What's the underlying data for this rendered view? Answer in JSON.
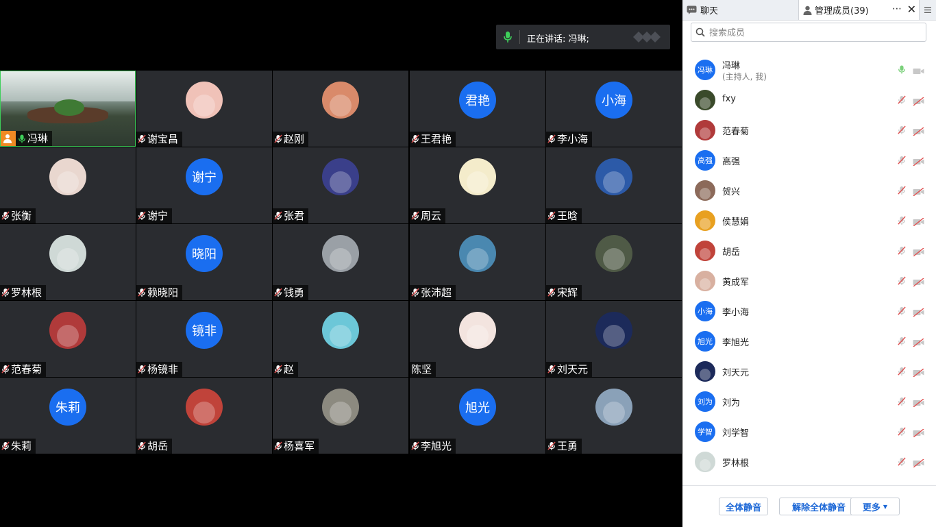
{
  "speaking_banner": {
    "text": "正在讲话: 冯琳;"
  },
  "tiles": [
    {
      "name": "冯琳",
      "kind": "video",
      "host": true,
      "mic": "on"
    },
    {
      "name": "谢宝昌",
      "kind": "photo",
      "avatar_color": "#f0c2b8",
      "mic": "off"
    },
    {
      "name": "赵刚",
      "kind": "photo",
      "avatar_color": "#d98a6a",
      "mic": "off"
    },
    {
      "name": "王君艳",
      "kind": "text",
      "avatar_text": "君艳",
      "avatar_color": "#1a6ef0",
      "mic": "off"
    },
    {
      "name": "李小海",
      "kind": "text",
      "avatar_text": "小海",
      "avatar_color": "#1a6ef0",
      "mic": "off"
    },
    {
      "name": "张衡",
      "kind": "photo",
      "avatar_color": "#e9d7cf",
      "mic": "off"
    },
    {
      "name": "谢宁",
      "kind": "text",
      "avatar_text": "谢宁",
      "avatar_color": "#1a6ef0",
      "mic": "off"
    },
    {
      "name": "张君",
      "kind": "photo",
      "avatar_color": "#3a3f8a",
      "mic": "off"
    },
    {
      "name": "周云",
      "kind": "photo",
      "avatar_color": "#f4eccb",
      "mic": "off"
    },
    {
      "name": "王晗",
      "kind": "photo",
      "avatar_color": "#2c5aa8",
      "mic": "off"
    },
    {
      "name": "罗林根",
      "kind": "photo",
      "avatar_color": "#cfd9d6",
      "mic": "off"
    },
    {
      "name": "赖晓阳",
      "kind": "text",
      "avatar_text": "晓阳",
      "avatar_color": "#1a6ef0",
      "mic": "off"
    },
    {
      "name": "钱勇",
      "kind": "photo",
      "avatar_color": "#9aa0a6",
      "mic": "off"
    },
    {
      "name": "张沛超",
      "kind": "photo",
      "avatar_color": "#4a88b0",
      "mic": "off"
    },
    {
      "name": "宋辉",
      "kind": "photo",
      "avatar_color": "#4f5a46",
      "mic": "off"
    },
    {
      "name": "范春菊",
      "kind": "photo",
      "avatar_color": "#b03a3a",
      "mic": "off"
    },
    {
      "name": "杨镜非",
      "kind": "text",
      "avatar_text": "镜非",
      "avatar_color": "#1a6ef0",
      "mic": "off"
    },
    {
      "name": "赵",
      "kind": "photo",
      "avatar_color": "#6cc7d8",
      "mic": "off"
    },
    {
      "name": "陈坚",
      "kind": "photo",
      "avatar_color": "#f3e4df",
      "mic": "none"
    },
    {
      "name": "刘天元",
      "kind": "photo",
      "avatar_color": "#1c2a5a",
      "mic": "off"
    },
    {
      "name": "朱莉",
      "kind": "text",
      "avatar_text": "朱莉",
      "avatar_color": "#1a6ef0",
      "mic": "off"
    },
    {
      "name": "胡岳",
      "kind": "photo",
      "avatar_color": "#c0433a",
      "mic": "off"
    },
    {
      "name": "杨喜军",
      "kind": "photo",
      "avatar_color": "#8c8a80",
      "mic": "off"
    },
    {
      "name": "李旭光",
      "kind": "text",
      "avatar_text": "旭光",
      "avatar_color": "#1a6ef0",
      "mic": "off"
    },
    {
      "name": "王勇",
      "kind": "photo",
      "avatar_color": "#8aa1b8",
      "mic": "off"
    }
  ],
  "panel": {
    "tab_chat": "聊天",
    "tab_members": "管理成员(39)",
    "more_icon": "⋯",
    "close_icon": "✕",
    "search_placeholder": "搜索成员",
    "members": [
      {
        "name": "冯琳",
        "sub": "(主持人, 我)",
        "avatar_text": "冯琳",
        "avatar_color": "#1a6ef0",
        "mic_active": true
      },
      {
        "name": "fxy",
        "avatar_color": "#3a4a2a"
      },
      {
        "name": "范春菊",
        "avatar_color": "#b03a3a"
      },
      {
        "name": "高强",
        "avatar_text": "高强",
        "avatar_color": "#1a6ef0"
      },
      {
        "name": "贺兴",
        "avatar_color": "#8c6a5a"
      },
      {
        "name": "侯慧娟",
        "avatar_color": "#e8a020"
      },
      {
        "name": "胡岳",
        "avatar_color": "#c0433a"
      },
      {
        "name": "黄成军",
        "avatar_color": "#d8b0a0"
      },
      {
        "name": "李小海",
        "avatar_text": "小海",
        "avatar_color": "#1a6ef0"
      },
      {
        "name": "李旭光",
        "avatar_text": "旭光",
        "avatar_color": "#1a6ef0"
      },
      {
        "name": "刘天元",
        "avatar_color": "#1c2a5a"
      },
      {
        "name": "刘为",
        "avatar_text": "刘为",
        "avatar_color": "#1a6ef0"
      },
      {
        "name": "刘学智",
        "avatar_text": "学智",
        "avatar_color": "#1a6ef0"
      },
      {
        "name": "罗林根",
        "avatar_color": "#cfd9d6"
      }
    ],
    "buttons": {
      "mute_all": "全体静音",
      "unmute_all": "解除全体静音",
      "more": "更多"
    }
  },
  "colors": {
    "accent": "#1a6ef0",
    "mic_on": "#3ecf5a",
    "mic_off": "#e05050",
    "host_badge": "#f08a24"
  }
}
